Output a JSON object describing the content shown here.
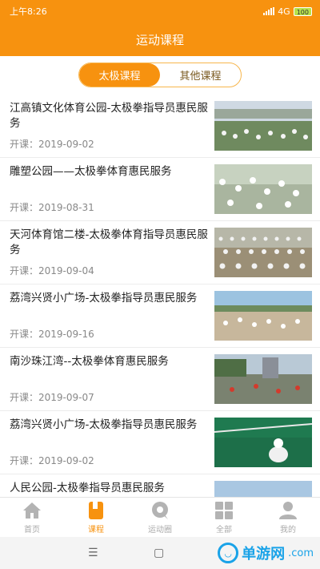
{
  "status": {
    "time": "上午8:26",
    "network": "4G",
    "battery": "100"
  },
  "header": {
    "title": "运动课程"
  },
  "tabs": [
    {
      "label": "太极课程",
      "active": true
    },
    {
      "label": "其他课程",
      "active": false
    }
  ],
  "courses": [
    {
      "title": "江高镇文化体育公园-太极拳指导员惠民服务",
      "date": "开课：2019-09-02"
    },
    {
      "title": "雕塑公园——太极拳体育惠民服务",
      "date": "开课：2019-08-31"
    },
    {
      "title": "天河体育馆二楼-太极拳体育指导员惠民服务",
      "date": "开课：2019-09-04"
    },
    {
      "title": "荔湾兴贤小广场-太极拳指导员惠民服务",
      "date": "开课：2019-09-16"
    },
    {
      "title": "南沙珠江湾--太极拳体育惠民服务",
      "date": "开课：2019-09-07"
    },
    {
      "title": "荔湾兴贤小广场-太极拳指导员惠民服务",
      "date": "开课：2019-09-02"
    },
    {
      "title": "人民公园-太极拳指导员惠民服务",
      "date": ""
    }
  ],
  "tabbar": [
    {
      "label": "首页",
      "icon": "home-icon",
      "active": false
    },
    {
      "label": "课程",
      "icon": "course-icon",
      "active": true
    },
    {
      "label": "运动圈",
      "icon": "chat-icon",
      "active": false
    },
    {
      "label": "全部",
      "icon": "grid-icon",
      "active": false
    },
    {
      "label": "我的",
      "icon": "user-icon",
      "active": false
    }
  ],
  "watermark": {
    "brand": "单游网",
    "domain": ".com"
  },
  "colors": {
    "accent": "#f7920f",
    "text": "#222222",
    "muted": "#888888"
  }
}
